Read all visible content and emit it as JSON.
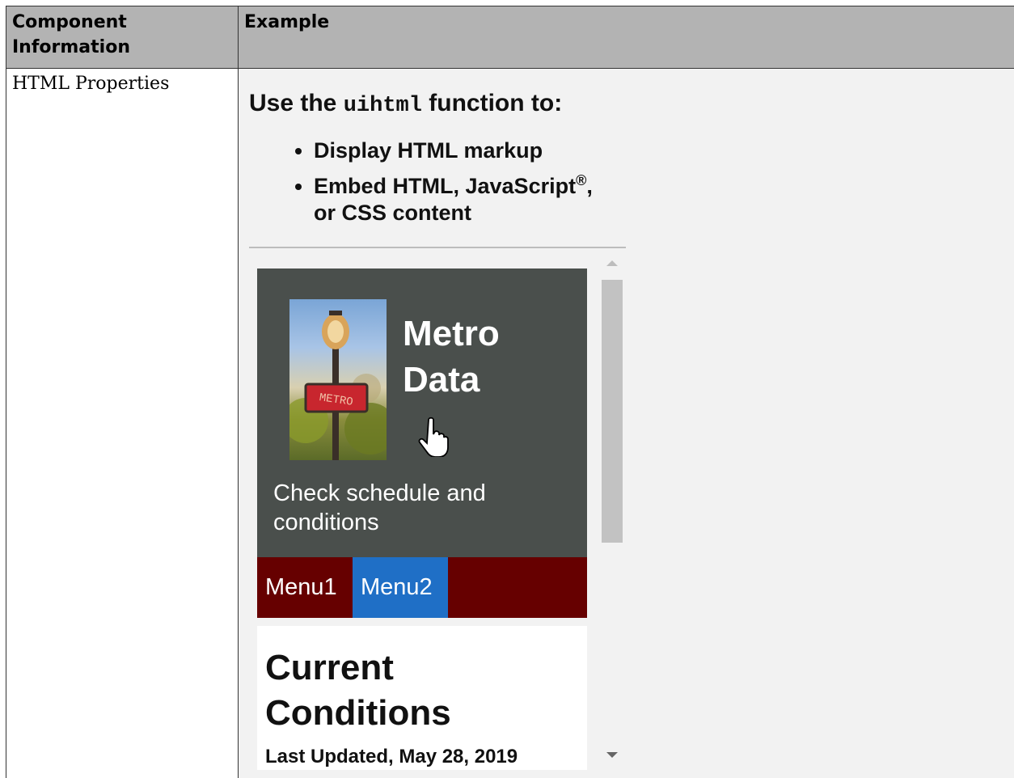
{
  "table": {
    "headers": [
      "Component Information",
      "Example"
    ],
    "row": {
      "component": "HTML Properties"
    }
  },
  "example": {
    "intro_prefix": "Use the ",
    "intro_code": "uihtml",
    "intro_suffix": " function to:",
    "bullets": [
      "Display HTML markup",
      "Embed HTML, JavaScript",
      "or CSS content"
    ],
    "registered_mark": "®",
    "app": {
      "title_line1": "Metro",
      "title_line2": "Data",
      "subtitle": "Check schedule and conditions",
      "sign_text": "METRO",
      "menu": [
        "Menu1",
        "Menu2"
      ],
      "active_menu": "Menu2",
      "content_title_line1": "Current",
      "content_title_line2": "Conditions",
      "last_updated": "Last Updated, May 28, 2019"
    },
    "colors": {
      "header_bg": "#b3b3b3",
      "hero_bg": "#4a4f4c",
      "menubar_bg": "#660000",
      "active_menu_bg": "#1f6fc6"
    }
  }
}
